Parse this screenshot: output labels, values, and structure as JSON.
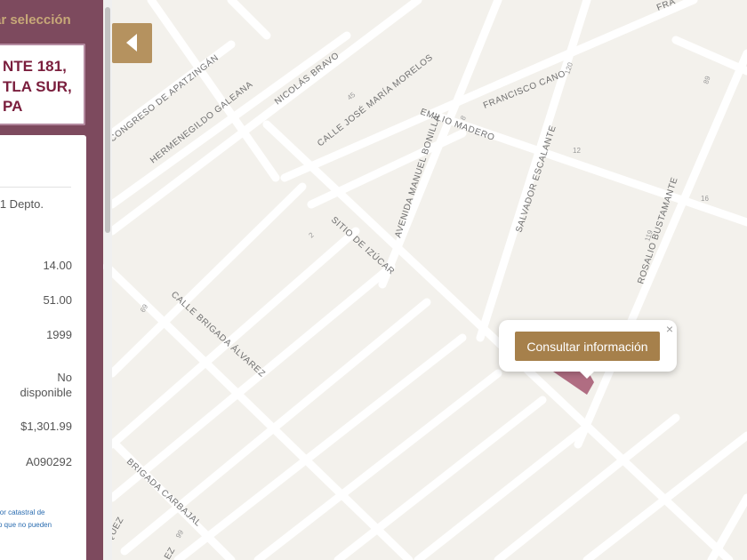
{
  "sidebar": {
    "title": "tar selección",
    "address_lines": [
      "NTE 181,",
      "TLA SUR,",
      "PA"
    ],
    "info_rows": [
      {
        "label_value": "1 Depto."
      },
      {
        "value": "14.00"
      },
      {
        "value": "51.00"
      },
      {
        "value": "1999"
      },
      {
        "value": "No"
      },
      {
        "value": "disponible"
      },
      {
        "value": "$1,301.99"
      },
      {
        "value": "A090292"
      }
    ],
    "note_lines": [
      "lor catastral de",
      "o que no pueden"
    ]
  },
  "collapse_button": {
    "icon": "chevron-left-icon"
  },
  "popup": {
    "button_label": "Consultar información",
    "close_symbol": "×"
  },
  "map": {
    "streets": [
      "CONGRESO DE APATZINGÁN",
      "HERMENEGILDO GALEANA",
      "NICOLÁS BRAVO",
      "CALLE JOSÉ MARÍA MORELOS",
      "FRANCISCO CANO",
      "EMILIO MADERO",
      "AVENIDA MANUEL BONILLA",
      "SALVADOR ESCALANTE",
      "ROSALIO BUSTAMANTE",
      "SITIO DE IZÚCAR",
      "CALLE BRIGADA ÁLVAREZ",
      "BRIGADA CARBAJAL",
      "FRA",
      "EZ",
      "QUEZ"
    ],
    "house_numbers": [
      "45",
      "8",
      "120",
      "12",
      "16",
      "119",
      "89",
      "2",
      "69",
      "99"
    ],
    "parcel_color": "#a35670"
  }
}
